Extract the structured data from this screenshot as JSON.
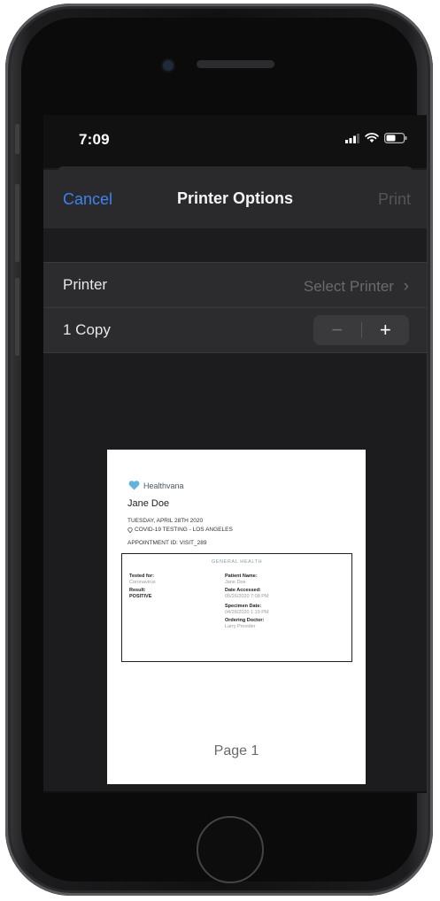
{
  "status_bar": {
    "time": "7:09",
    "icons": [
      "signal-icon",
      "wifi-icon",
      "battery-icon"
    ]
  },
  "nav": {
    "cancel_label": "Cancel",
    "title": "Printer Options",
    "print_label": "Print"
  },
  "printer_row": {
    "label": "Printer",
    "value": "Select Printer",
    "chevron": "›"
  },
  "copies_row": {
    "label": "1 Copy",
    "minus": "−",
    "plus": "+"
  },
  "preview": {
    "logo_text": "Healthvana",
    "patient": "Jane Doe",
    "date_line": "TUESDAY, APRIL 28TH 2020",
    "location_line": "COVID-19 TESTING - LOS ANGELES",
    "appointment_line": "APPOINTMENT ID: VISIT_289",
    "box_title": "GENERAL HEALTH",
    "tested_for_label": "Tested for:",
    "tested_for_value": "Coronavirus",
    "result_label": "Result:",
    "result_value": "POSITIVE",
    "patient_name_label": "Patient Name:",
    "patient_name_value": "Jane Doe",
    "date_accessed_label": "Date Accessed:",
    "date_accessed_value": "05/26/2020 7:08 PM",
    "specimen_date_label": "Specimen Date:",
    "specimen_date_value": "04/28/2020 1:19 PM",
    "ordering_doctor_label": "Ordering Doctor:",
    "ordering_doctor_value": "Larry Provider",
    "page_label": "Page 1"
  },
  "colors": {
    "accent": "#3d82f0",
    "logo_heart": "#5bb5e0",
    "background": "#1c1c1e"
  }
}
